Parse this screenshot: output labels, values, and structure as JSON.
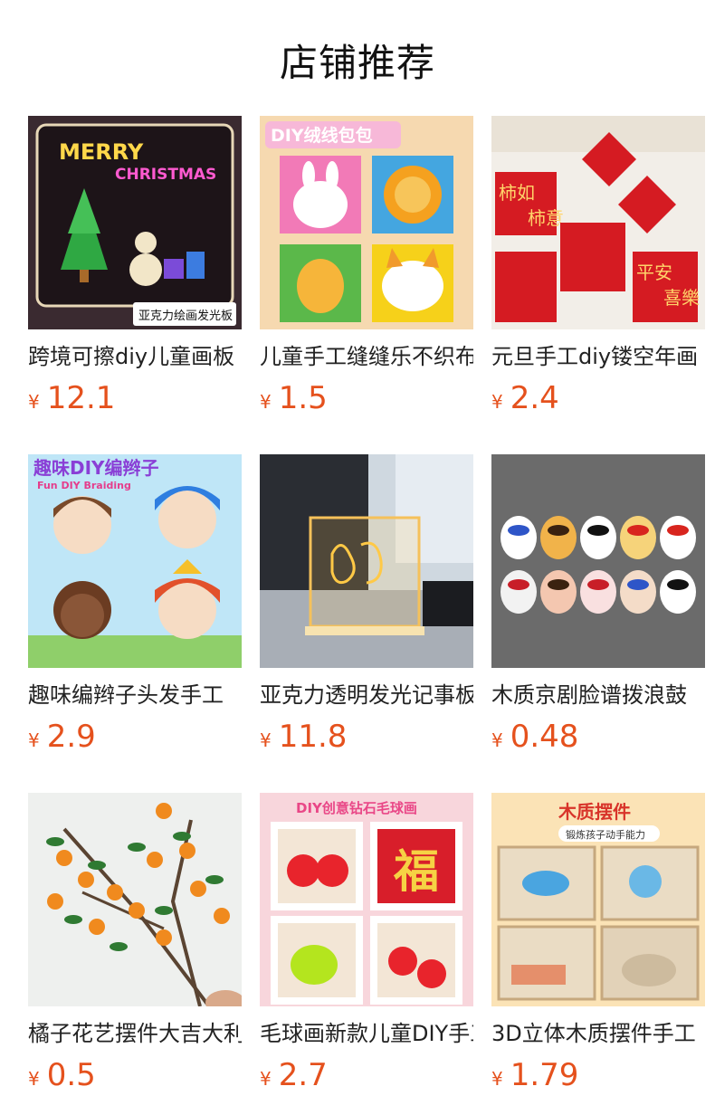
{
  "section": {
    "title": "店铺推荐"
  },
  "currency_symbol": "¥",
  "products": [
    {
      "name": "跨境可擦diy儿童画板",
      "price": "12.1",
      "image": "acrylic-christmas-board",
      "image_text": [
        "MERRY",
        "CHRISTMAS",
        "亚克力绘画发光板"
      ]
    },
    {
      "name": "儿童手工缝缝乐不织布",
      "price": "1.5",
      "image": "felt-animal-bags",
      "image_text": [
        "DIY绒线包包"
      ]
    },
    {
      "name": "元旦手工diy镂空年画",
      "price": "2.4",
      "image": "new-year-paper-cut",
      "image_text": [
        "柿如",
        "柿意",
        "平安",
        "喜樂"
      ]
    },
    {
      "name": "趣味编辫子头发手工",
      "price": "2.9",
      "image": "braiding-dolls",
      "image_text": [
        "趣味DIY编辫子",
        "Fun DIY Braiding"
      ]
    },
    {
      "name": "亚克力透明发光记事板",
      "price": "11.8",
      "image": "glowing-acrylic-note-board",
      "image_text": []
    },
    {
      "name": "木质京剧脸谱拨浪鼓",
      "price": "0.48",
      "image": "peking-opera-masks",
      "image_text": []
    },
    {
      "name": "橘子花艺摆件大吉大利",
      "price": "0.5",
      "image": "orange-branch-decor",
      "image_text": []
    },
    {
      "name": "毛球画新款儿童DIY手工",
      "price": "2.7",
      "image": "pompom-painting-frames",
      "image_text": [
        "DIY创意钻石毛球画",
        "福"
      ]
    },
    {
      "name": "3D立体木质摆件手工",
      "price": "1.79",
      "image": "wooden-3d-ornament",
      "image_text": [
        "木质摆件",
        "锻炼孩子动手能力"
      ]
    }
  ]
}
